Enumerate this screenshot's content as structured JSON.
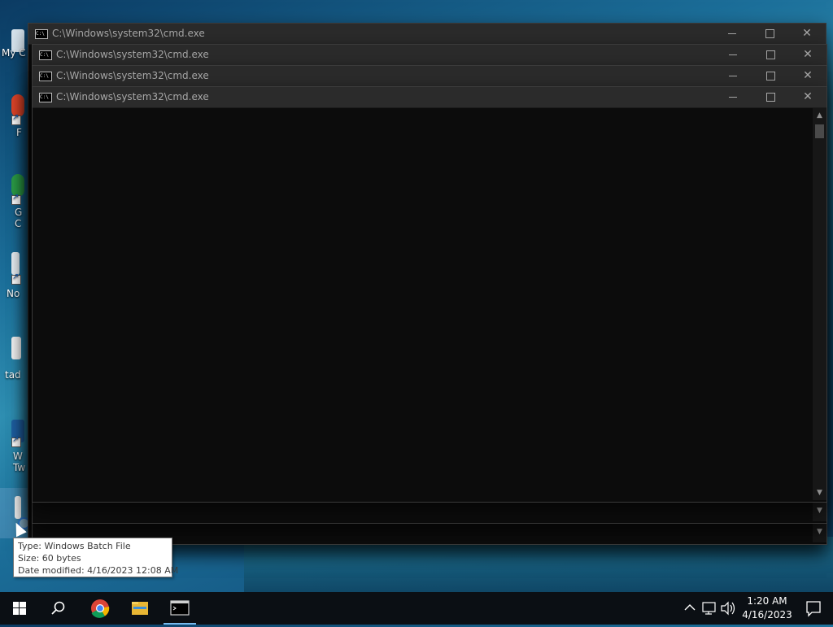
{
  "desktop": {
    "icons": [
      {
        "name": "my-computer",
        "label": "My C"
      },
      {
        "name": "firefox",
        "label": "F"
      },
      {
        "name": "google-chrome",
        "label": "G\nC"
      },
      {
        "name": "notepad",
        "label": "No"
      },
      {
        "name": "tad",
        "label": "tad"
      },
      {
        "name": "w-tw",
        "label": "W\nTw"
      }
    ]
  },
  "windows": [
    {
      "title": "C:\\Windows\\system32\\cmd.exe"
    },
    {
      "title": "C:\\Windows\\system32\\cmd.exe"
    },
    {
      "title": "C:\\Windows\\system32\\cmd.exe"
    },
    {
      "title": "C:\\Windows\\system32\\cmd.exe"
    }
  ],
  "tooltip": {
    "type": "Type: Windows Batch File",
    "size": "Size: 60 bytes",
    "modified": "Date modified: 4/16/2023 12:08 AM"
  },
  "taskbar": {
    "start": "windows-logo-icon",
    "search": "search-icon",
    "apps": [
      "chrome-icon",
      "file-explorer-icon",
      "cmd-icon"
    ],
    "tray": {
      "time": "1:20 AM",
      "date": "4/16/2023",
      "icons": [
        "chevron-up-icon",
        "network-icon",
        "volume-icon",
        "notification-icon"
      ]
    }
  },
  "colors": {
    "console_bg": "#0c0c0c",
    "titlebar_bg": "#2b2b2b",
    "taskbar_bg": "#0b0f14",
    "active_indicator": "#76b9ed"
  }
}
